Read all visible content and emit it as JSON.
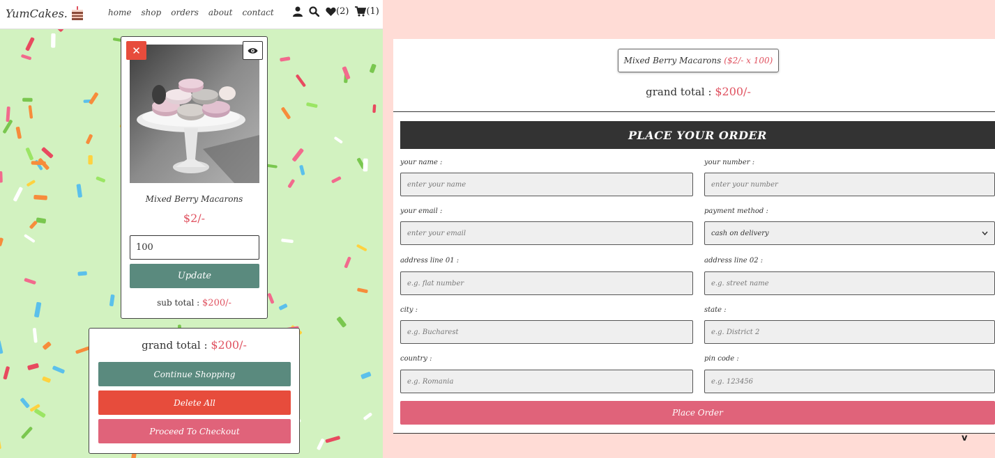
{
  "header": {
    "logo_text": "YumCakes.",
    "nav": [
      "home",
      "shop",
      "orders",
      "about",
      "contact"
    ],
    "wishlist_count": "(2)",
    "cart_count": "(1)",
    "icons": [
      "user-icon",
      "search-icon",
      "heart-icon",
      "cart-icon"
    ]
  },
  "cart": {
    "item": {
      "name": "Mixed Berry Macarons",
      "price": "$2/-",
      "quantity": "100",
      "update_label": "Update",
      "subtotal_label": "sub total :",
      "subtotal_value": "$200/-",
      "remove_icon": "close-icon",
      "view_icon": "eye-icon"
    },
    "grand_total_label": "grand total :",
    "grand_total_value": "$200/-",
    "buttons": {
      "continue": "Continue Shopping",
      "delete_all": "Delete All",
      "checkout": "Proceed To Checkout"
    }
  },
  "checkout": {
    "summary_item": "Mixed Berry Macarons",
    "summary_detail": "($2/- x 100)",
    "grand_total_label": "grand total :",
    "grand_total_value": "$200/-",
    "form_title": "PLACE YOUR ORDER",
    "fields": {
      "name": {
        "label": "your name :",
        "placeholder": "enter your name"
      },
      "number": {
        "label": "your number :",
        "placeholder": "enter your number"
      },
      "email": {
        "label": "your email :",
        "placeholder": "enter your email"
      },
      "payment": {
        "label": "payment method :",
        "value": "cash on delivery"
      },
      "address1": {
        "label": "address line 01 :",
        "placeholder": "e.g. flat number"
      },
      "address2": {
        "label": "address line 02 :",
        "placeholder": "e.g. street name"
      },
      "city": {
        "label": "city :",
        "placeholder": "e.g. Bucharest"
      },
      "state": {
        "label": "state :",
        "placeholder": "e.g. District 2"
      },
      "country": {
        "label": "country :",
        "placeholder": "e.g. Romania"
      },
      "pincode": {
        "label": "pin code :",
        "placeholder": "e.g. 123456"
      }
    },
    "submit_label": "Place Order"
  },
  "colors": {
    "accent_red": "#e05260",
    "teal_button": "#5a8a7e",
    "delete_red": "#e74c3c",
    "pink_button": "#e0637a",
    "page_bg": "#ffdcd6",
    "header_dark": "#333333"
  }
}
